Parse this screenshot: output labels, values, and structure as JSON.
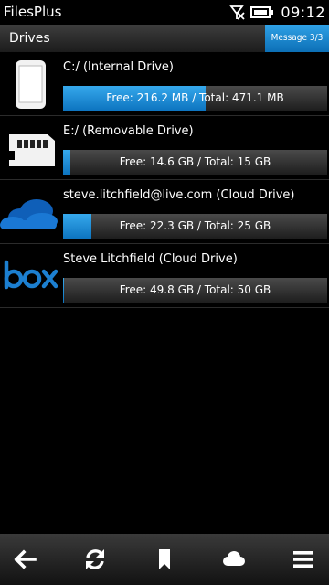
{
  "status": {
    "app_title": "FilesPlus",
    "time": "09:12",
    "signal_icon": "no-signal-icon",
    "battery_icon": "battery-full-icon"
  },
  "header": {
    "title": "Drives",
    "message_badge": "Message 3/3"
  },
  "colors": {
    "accent": "#1a8ad6",
    "background": "#000000",
    "bar_track": "#333333"
  },
  "drives": [
    {
      "icon": "phone-icon",
      "name": "C:/  (Internal Drive)",
      "usage": "Free: 216.2 MB / Total: 471.1 MB",
      "used_fraction": 0.54
    },
    {
      "icon": "sd-card-icon",
      "name": "E:/  (Removable Drive)",
      "usage": "Free: 14.6 GB / Total: 15 GB",
      "used_fraction": 0.027
    },
    {
      "icon": "onedrive-cloud-icon",
      "name": "steve.litchfield@live.com  (Cloud Drive)",
      "usage": "Free: 22.3 GB / Total: 25 GB",
      "used_fraction": 0.108
    },
    {
      "icon": "box-logo-icon",
      "name": "Steve Litchfield  (Cloud Drive)",
      "usage": "Free: 49.8 GB / Total: 50 GB",
      "used_fraction": 0.004
    }
  ],
  "toolbar": {
    "buttons": [
      "back-arrow-icon",
      "refresh-icon",
      "bookmark-icon",
      "cloud-icon",
      "menu-icon"
    ]
  }
}
